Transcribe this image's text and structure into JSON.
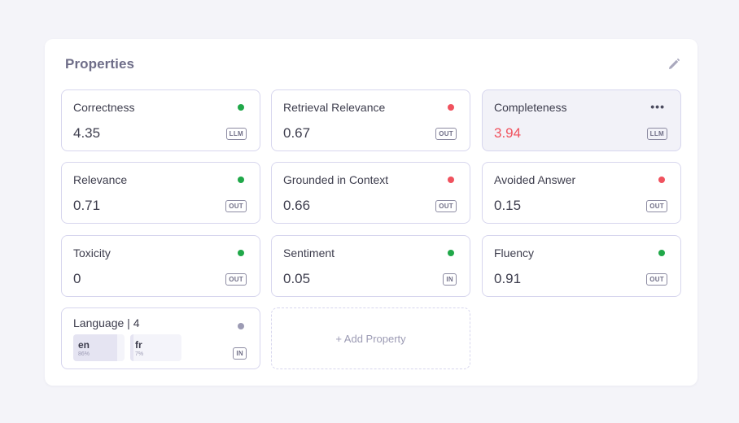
{
  "panel": {
    "title": "Properties",
    "edit_icon": "pencil-icon"
  },
  "cards": [
    {
      "name": "Correctness",
      "value": "4.35",
      "status": "green",
      "badge": "LLM"
    },
    {
      "name": "Retrieval Relevance",
      "value": "0.67",
      "status": "red",
      "badge": "OUT"
    },
    {
      "name": "Completeness",
      "value": "3.94",
      "status": "more",
      "badge": "LLM",
      "value_color": "#f0525e",
      "highlighted": true
    },
    {
      "name": "Relevance",
      "value": "0.71",
      "status": "green",
      "badge": "OUT"
    },
    {
      "name": "Grounded in Context",
      "value": "0.66",
      "status": "red",
      "badge": "OUT"
    },
    {
      "name": "Avoided Answer",
      "value": "0.15",
      "status": "red",
      "badge": "OUT"
    },
    {
      "name": "Toxicity",
      "value": "0",
      "status": "green",
      "badge": "OUT"
    },
    {
      "name": "Sentiment",
      "value": "0.05",
      "status": "green",
      "badge": "IN"
    },
    {
      "name": "Fluency",
      "value": "0.91",
      "status": "green",
      "badge": "OUT"
    }
  ],
  "language_card": {
    "name": "Language | 4",
    "status": "gray",
    "badge": "IN",
    "languages": [
      {
        "code": "en",
        "pct": "86%",
        "fraction": 0.86
      },
      {
        "code": "fr",
        "pct": "7%",
        "fraction": 0.07
      }
    ]
  },
  "add_property": {
    "label": "+ Add Property"
  },
  "more_icon_text": "•••",
  "colors": {
    "green": "#20a849",
    "red": "#f0525e",
    "gray": "#9c9bb4",
    "border": "#d7d6ee"
  }
}
